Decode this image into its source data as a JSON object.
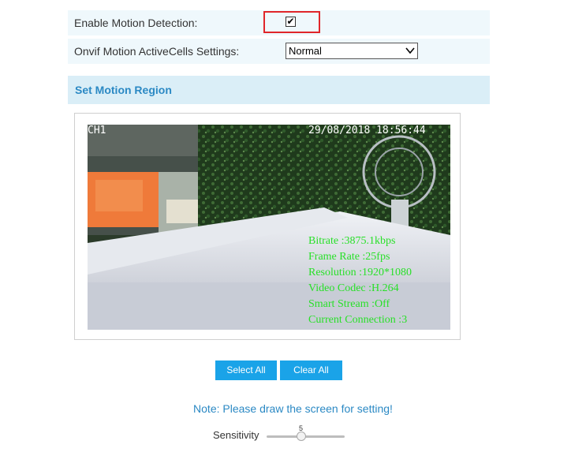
{
  "settings": {
    "motion_detection_label": "Enable Motion Detection:",
    "motion_detection_checked": true,
    "onvif_label": "Onvif Motion ActiveCells Settings:",
    "onvif_value": "Normal"
  },
  "region": {
    "title": "Set Motion Region"
  },
  "video": {
    "channel": "CH1",
    "timestamp": "29/08/2018 18:56:44",
    "bitrate": "Bitrate :3875.1kbps",
    "frame_rate": "Frame Rate :25fps",
    "resolution": "Resolution :1920*1080",
    "codec": "Video Codec :H.264",
    "smart_stream": "Smart Stream :Off",
    "connection": "Current Connection :3"
  },
  "buttons": {
    "select_all": "Select All",
    "clear_all": "Clear All"
  },
  "note": "Note: Please draw the screen for setting!",
  "sensitivity": {
    "label": "Sensitivity",
    "value": "5",
    "level": 5,
    "max": 10
  },
  "colors": {
    "accent": "#1aa3e8",
    "title_blue": "#2b89c4",
    "highlight_red": "#e0262a",
    "osd_green": "#28e028"
  }
}
